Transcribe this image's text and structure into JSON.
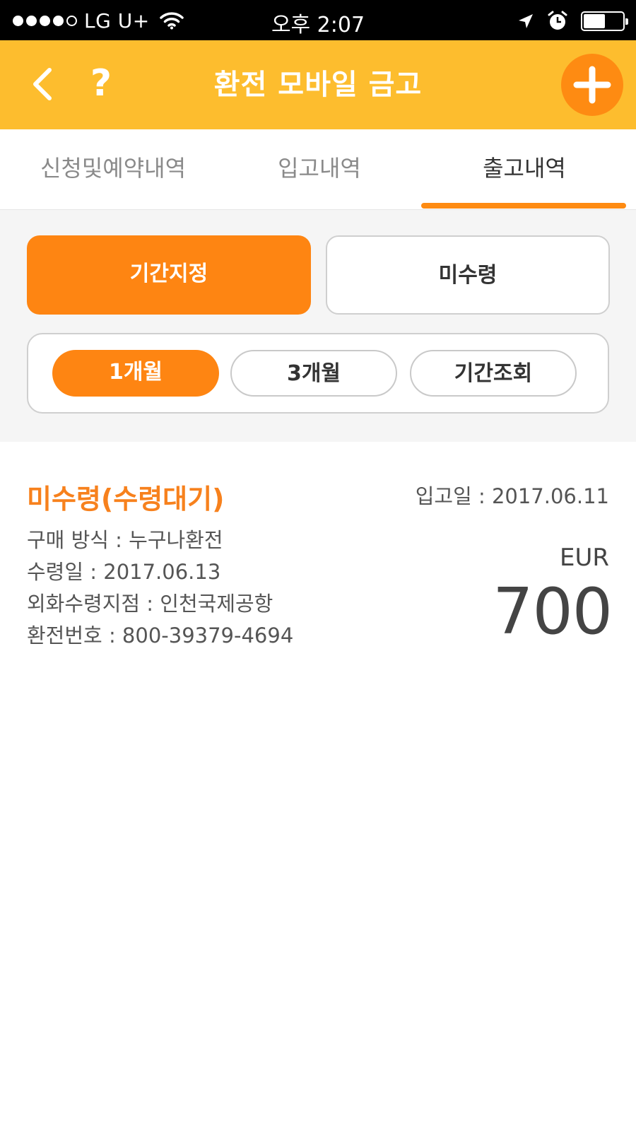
{
  "status_bar": {
    "carrier": "LG U+",
    "time": "오후 2:07",
    "battery_level": 0.55
  },
  "header": {
    "title": "환전 모바일 금고",
    "help_label": "?"
  },
  "tabs": [
    {
      "label": "신청및예약내역",
      "active": false
    },
    {
      "label": "입고내역",
      "active": false
    },
    {
      "label": "출고내역",
      "active": true
    }
  ],
  "filters": {
    "primary": [
      {
        "label": "기간지정",
        "active": true
      },
      {
        "label": "미수령",
        "active": false
      }
    ],
    "period": [
      {
        "label": "1개월",
        "active": true
      },
      {
        "label": "3개월",
        "active": false
      },
      {
        "label": "기간조회",
        "active": false
      }
    ]
  },
  "record": {
    "status": "미수령(수령대기)",
    "deposit_date": "입고일 : 2017.06.11",
    "purchase_method": "구매 방식 : 누구나환전",
    "receive_date": "수령일 : 2017.06.13",
    "branch": "외화수령지점 : 인천국제공항",
    "exchange_number": "환전번호 : 800-39379-4694",
    "currency": "EUR",
    "amount": "700"
  },
  "colors": {
    "header": "#fdbd2e",
    "accent": "#fe8512",
    "status_text": "#f7811d"
  },
  "icons": [
    "back-chevron-icon",
    "help-icon",
    "add-icon",
    "wifi-icon",
    "location-arrow-icon",
    "alarm-icon",
    "battery-icon"
  ]
}
